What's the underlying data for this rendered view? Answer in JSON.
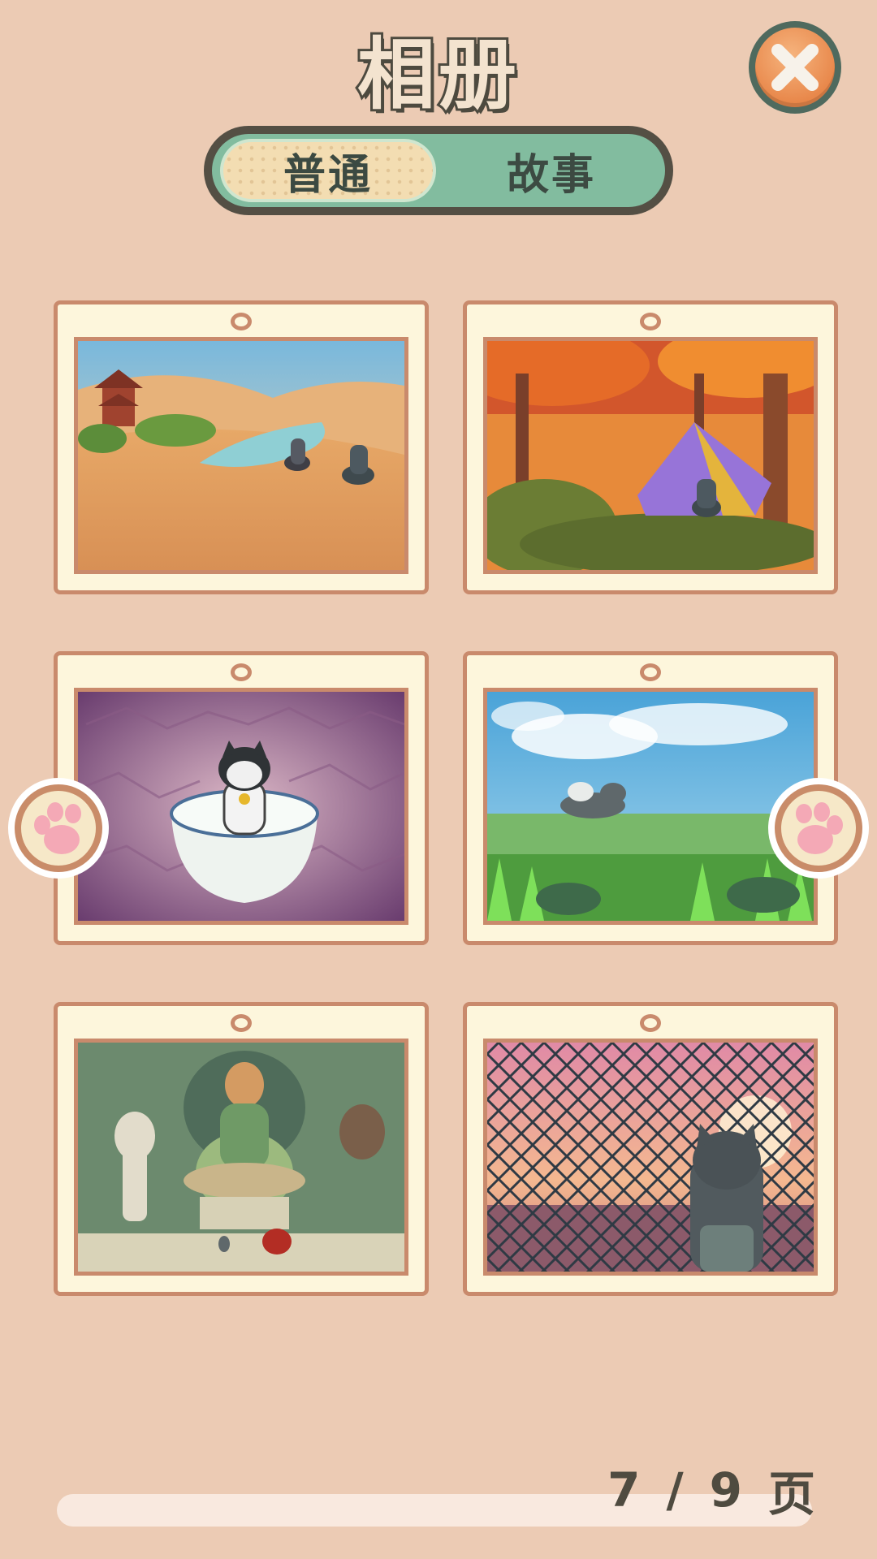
{
  "header": {
    "title": "相册"
  },
  "close_button": {
    "icon": "close-icon",
    "color": "#e8874a"
  },
  "tabs": [
    {
      "label": "普通",
      "selected": true
    },
    {
      "label": "故事",
      "selected": false
    }
  ],
  "album": {
    "photos": [
      {
        "scene": "desert-oasis"
      },
      {
        "scene": "autumn-camp-tent"
      },
      {
        "scene": "dog-in-bowl"
      },
      {
        "scene": "meadow-running"
      },
      {
        "scene": "cave-buddha-statues"
      },
      {
        "scene": "sunset-fence"
      }
    ]
  },
  "navigation": {
    "prev_icon": "paw-icon",
    "next_icon": "paw-icon"
  },
  "pagination": {
    "current": "7",
    "separator": "/",
    "total": "9",
    "unit": "页"
  },
  "colors": {
    "background": "#eccbb4",
    "frame": "#c98a6c",
    "tab_track": "#82bc9f"
  }
}
